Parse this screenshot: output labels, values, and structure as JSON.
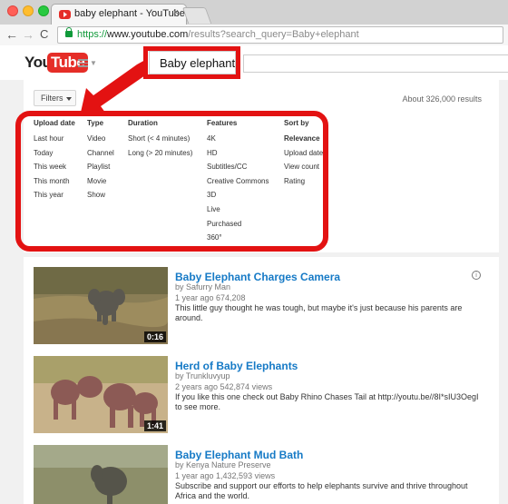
{
  "browser": {
    "tab_title": "baby elephant - YouTube",
    "tab_close": "×",
    "url_scheme": "https://",
    "url_host": "www.youtube.com",
    "url_path": "/results?search_query=Baby+elephant",
    "back_glyph": "←",
    "forward_glyph": "→",
    "reload_glyph": "C"
  },
  "youtube": {
    "logo_you": "You",
    "logo_tube": "Tube",
    "search_query": "Baby elephant",
    "filters_label": "Filters",
    "results_count": "About 326,000 results"
  },
  "filters": {
    "upload_date": {
      "heading": "Upload date",
      "items": [
        "Last hour",
        "Today",
        "This week",
        "This month",
        "This year"
      ]
    },
    "type": {
      "heading": "Type",
      "items": [
        "Video",
        "Channel",
        "Playlist",
        "Movie",
        "Show"
      ]
    },
    "duration": {
      "heading": "Duration",
      "items": [
        "Short (< 4 minutes)",
        "Long (> 20 minutes)"
      ]
    },
    "features": {
      "heading": "Features",
      "items": [
        "4K",
        "HD",
        "Subtitles/CC",
        "Creative Commons",
        "3D",
        "Live",
        "Purchased",
        "360°"
      ]
    },
    "sort_by": {
      "heading": "Sort by",
      "items": [
        "Relevance",
        "Upload date",
        "View count",
        "Rating"
      ]
    }
  },
  "results": [
    {
      "title": "Baby Elephant Charges Camera",
      "channel": "by Safurry Man",
      "meta": "1 year ago 674,208",
      "description": "This little guy thought he was tough, but maybe it's just because his parents are around.",
      "duration": "0:16"
    },
    {
      "title": "Herd of Baby Elephants",
      "channel": "by Trunkluvyup",
      "meta": "2 years ago  542,874 views",
      "description": "If you like this one check out Baby Rhino Chases Tail at http://youtu.be//8I*sIU3OegI  to see more.",
      "duration": "1:41"
    },
    {
      "title": "Baby Elephant Mud Bath",
      "channel": "by Kenya Nature Preserve",
      "meta": "1 year ago  1,432,593 views",
      "description": "Subscribe and support our efforts to help elephants survive and thrive throughout Africa and the world.",
      "duration": ""
    }
  ],
  "annotation_color": "#e31212"
}
